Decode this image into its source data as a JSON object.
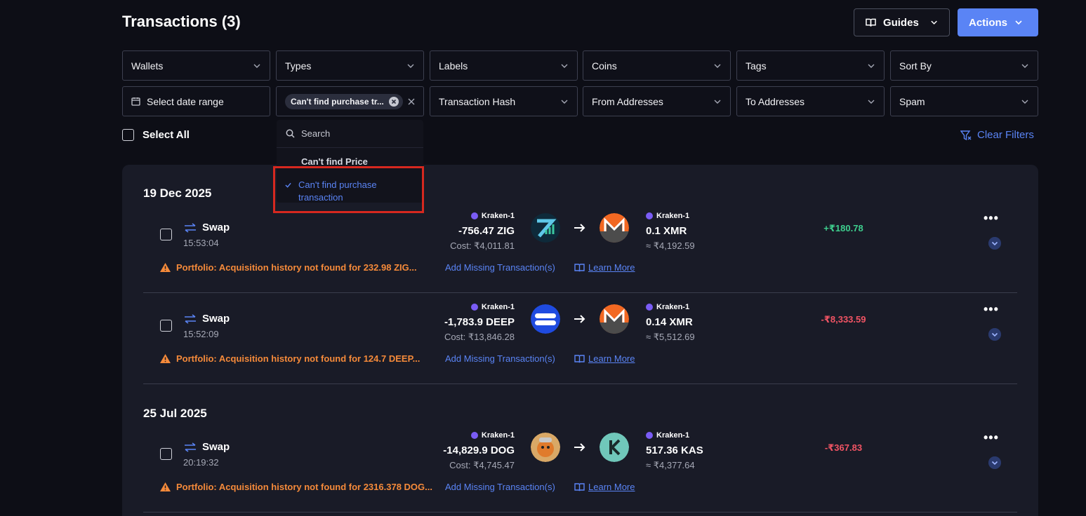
{
  "header": {
    "title": "Transactions (3)",
    "guides_label": "Guides",
    "actions_label": "Actions"
  },
  "filters": {
    "row1": [
      "Wallets",
      "Types",
      "Labels",
      "Coins",
      "Tags",
      "Sort By"
    ],
    "date_range": "Select date range",
    "types_chip": "Can't find purchase tr...",
    "row2": [
      "Transaction Hash",
      "From Addresses",
      "To Addresses",
      "Spam"
    ]
  },
  "select_all_label": "Select All",
  "clear_filters_label": "Clear Filters",
  "dropdown": {
    "search_placeholder": "Search",
    "items": [
      "Can't find Price",
      "Can't find purchase transaction"
    ],
    "selected_index": 1
  },
  "groups": [
    {
      "date": "19 Dec 2025"
    },
    {
      "date": "25 Jul 2025"
    }
  ],
  "transactions": [
    {
      "type": "Swap",
      "time": "15:53:04",
      "from_wallet": "Kraken-1",
      "from_amount": "-756.47 ZIG",
      "from_cost": "Cost: ₹4,011.81",
      "to_wallet": "Kraken-1",
      "to_amount": "0.1 XMR",
      "to_value": "≈ ₹4,192.59",
      "pnl": "+₹180.78",
      "warning": "Portfolio: Acquisition history not found for 232.98 ZIG...",
      "add_missing": "Add Missing Transaction(s)",
      "learn_more": "Learn More"
    },
    {
      "type": "Swap",
      "time": "15:52:09",
      "from_wallet": "Kraken-1",
      "from_amount": "-1,783.9 DEEP",
      "from_cost": "Cost: ₹13,846.28",
      "to_wallet": "Kraken-1",
      "to_amount": "0.14 XMR",
      "to_value": "≈ ₹5,512.69",
      "pnl": "-₹8,333.59",
      "warning": "Portfolio: Acquisition history not found for 124.7 DEEP...",
      "add_missing": "Add Missing Transaction(s)",
      "learn_more": "Learn More"
    },
    {
      "type": "Swap",
      "time": "20:19:32",
      "from_wallet": "Kraken-1",
      "from_amount": "-14,829.9 DOG",
      "from_cost": "Cost: ₹4,745.47",
      "to_wallet": "Kraken-1",
      "to_amount": "517.36 KAS",
      "to_value": "≈ ₹4,377.64",
      "pnl": "-₹367.83",
      "warning": "Portfolio: Acquisition history not found for 2316.378 DOG...",
      "add_missing": "Add Missing Transaction(s)",
      "learn_more": "Learn More"
    }
  ],
  "colors": {
    "accent": "#5a84f5",
    "positive": "#3ecf8e",
    "negative": "#f25464",
    "warning": "#f58a3a",
    "highlight": "#d6281f"
  }
}
